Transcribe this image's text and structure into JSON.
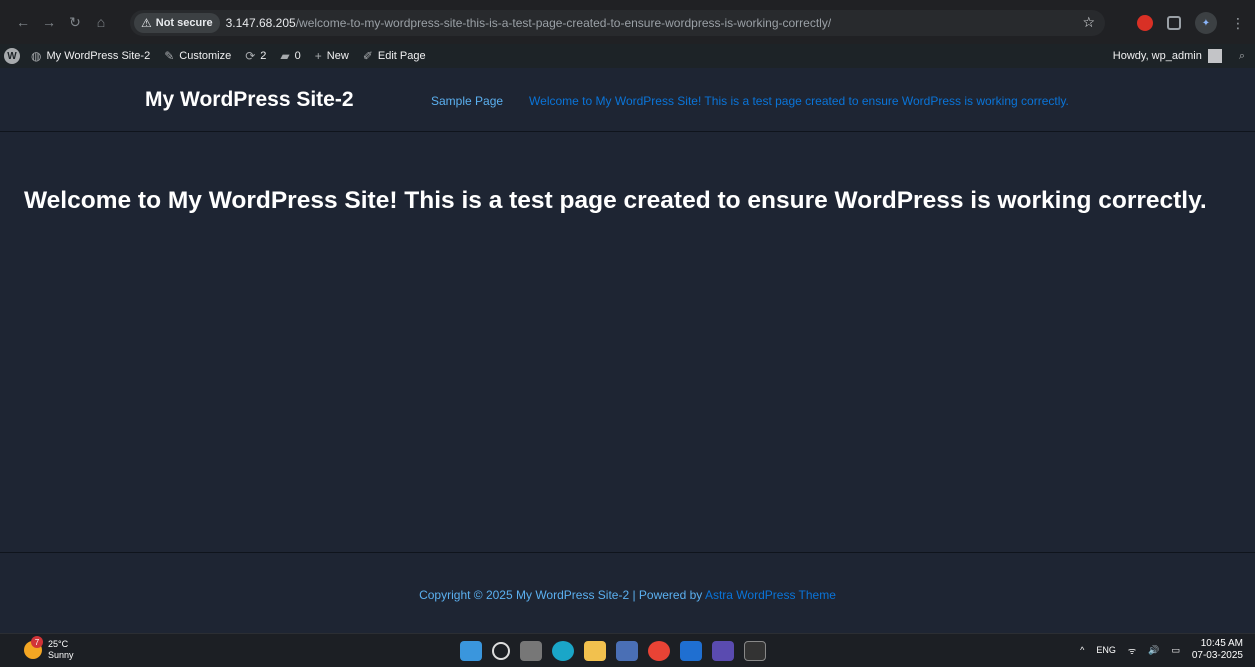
{
  "browser": {
    "security_label": "Not secure",
    "url_host": "3.147.68.205",
    "url_path": "/welcome-to-my-wordpress-site-this-is-a-test-page-created-to-ensure-wordpress-is-working-correctly/"
  },
  "admin_bar": {
    "site_name": "My WordPress Site-2",
    "customize": "Customize",
    "updates_count": "2",
    "comments_count": "0",
    "new_label": "New",
    "edit_page": "Edit Page",
    "howdy": "Howdy, wp_admin"
  },
  "site": {
    "title": "My WordPress Site-2",
    "menu": [
      {
        "label": "Sample Page"
      },
      {
        "label": "Welcome to My WordPress Site! This is a test page created to ensure WordPress is working correctly."
      }
    ]
  },
  "page": {
    "heading": "Welcome to My WordPress Site! This is a test page created to ensure WordPress is working correctly."
  },
  "footer": {
    "text": "Copyright © 2025 My WordPress Site-2 | Powered by ",
    "theme_link": "Astra WordPress Theme"
  },
  "taskbar": {
    "weather_temp": "25°C",
    "weather_desc": "Sunny",
    "weather_badge": "7",
    "lang": "ENG",
    "time": "10:45 AM",
    "date": "07-03-2025"
  },
  "colors": {
    "background": "#1e2533",
    "link": "#5bb0f0",
    "accent_link": "#0a74d8",
    "admin_bar": "#1d2327"
  }
}
